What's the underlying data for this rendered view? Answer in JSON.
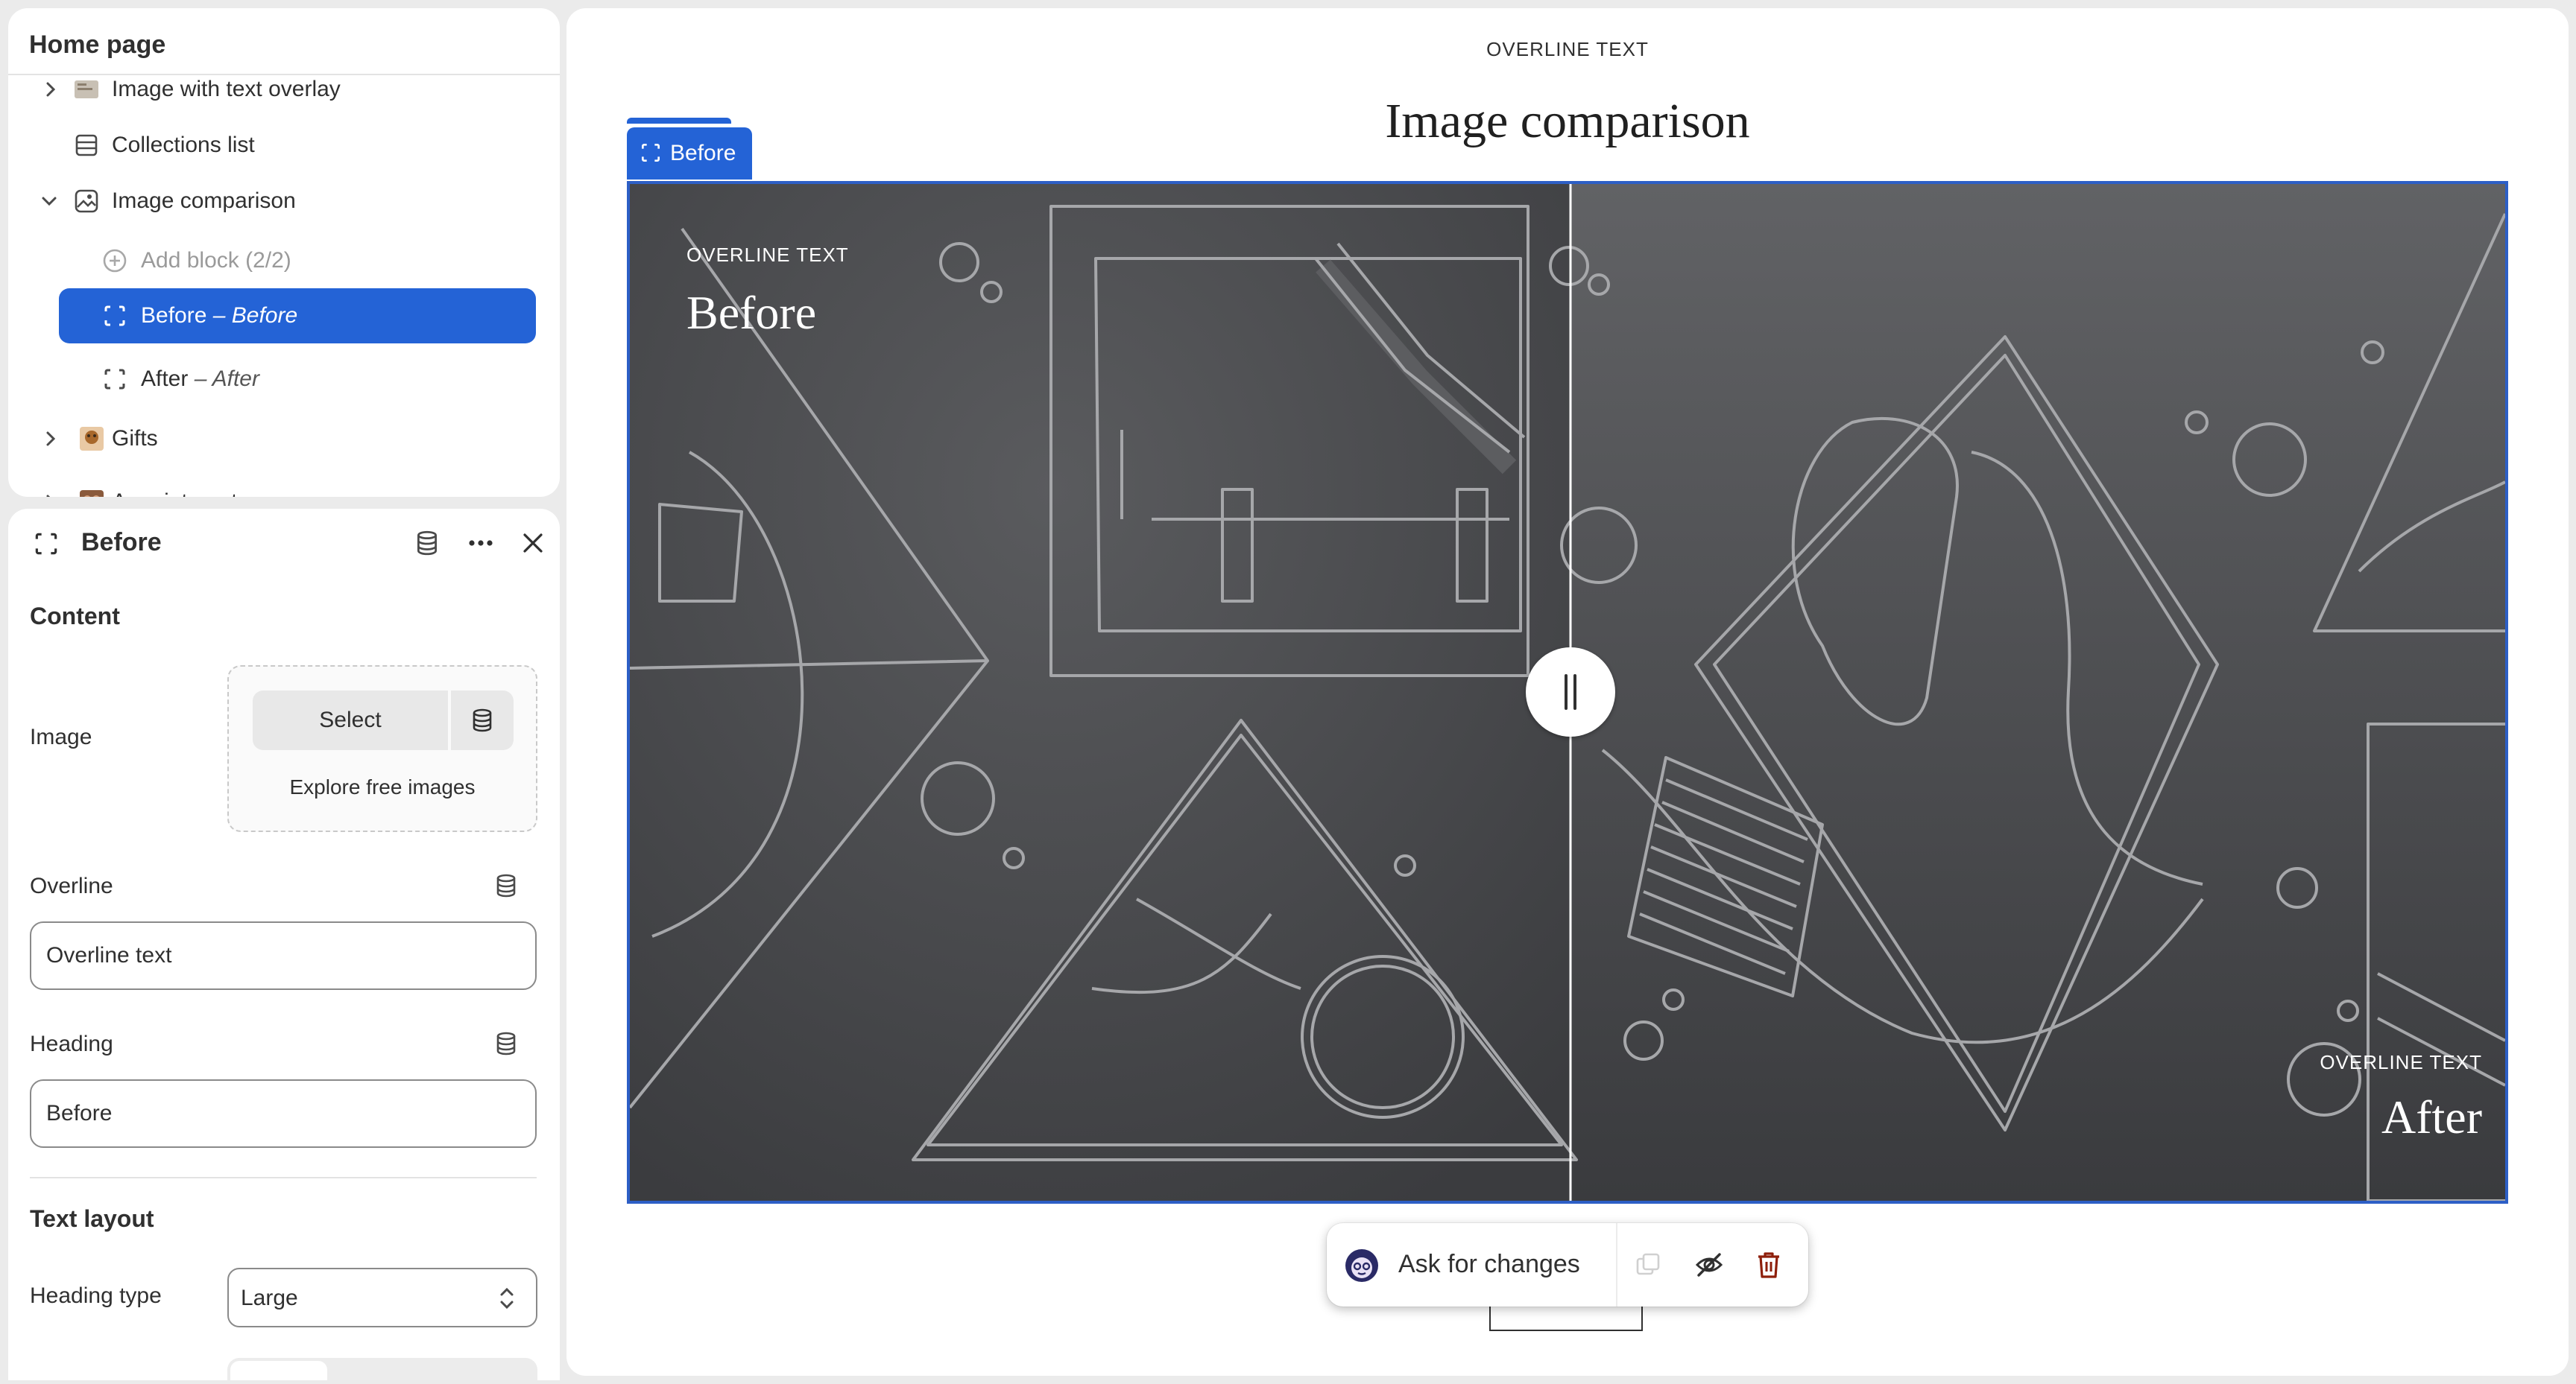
{
  "sidebar": {
    "title": "Home page",
    "items": [
      {
        "label": "Image with text overlay",
        "sub": ""
      },
      {
        "label": "Collections list",
        "sub": ""
      },
      {
        "label": "Image comparison",
        "sub": ""
      },
      {
        "label": "Add block (2/2)",
        "sub": ""
      },
      {
        "label": "Before",
        "sub": "– Before"
      },
      {
        "label": "After",
        "sub": "– After"
      },
      {
        "label": "Gifts",
        "sub": ""
      },
      {
        "label": "Appointments",
        "sub": ""
      }
    ]
  },
  "settings": {
    "title": "Before",
    "content_heading": "Content",
    "image_label": "Image",
    "select_label": "Select",
    "explore_label": "Explore free images",
    "overline_label": "Overline",
    "overline_value": "Overline text",
    "heading_label": "Heading",
    "heading_value": "Before",
    "text_layout_heading": "Text layout",
    "heading_type_label": "Heading type",
    "heading_type_value": "Large"
  },
  "preview": {
    "section_overline": "OVERLINE TEXT",
    "section_title": "Image comparison",
    "selected_tab": "Before",
    "before_overline": "OVERLINE TEXT",
    "before_heading": "Before",
    "after_overline": "OVERLINE TEXT",
    "after_heading": "After",
    "slider_position": 0.5
  },
  "toolbar": {
    "ask_label": "Ask for changes"
  },
  "colors": {
    "accent": "#2463d6",
    "panel_bg": "#ffffff",
    "app_bg": "#ebebeb",
    "canvas_dark": "#3a3b3e",
    "delete_red": "#8e1f0b"
  }
}
